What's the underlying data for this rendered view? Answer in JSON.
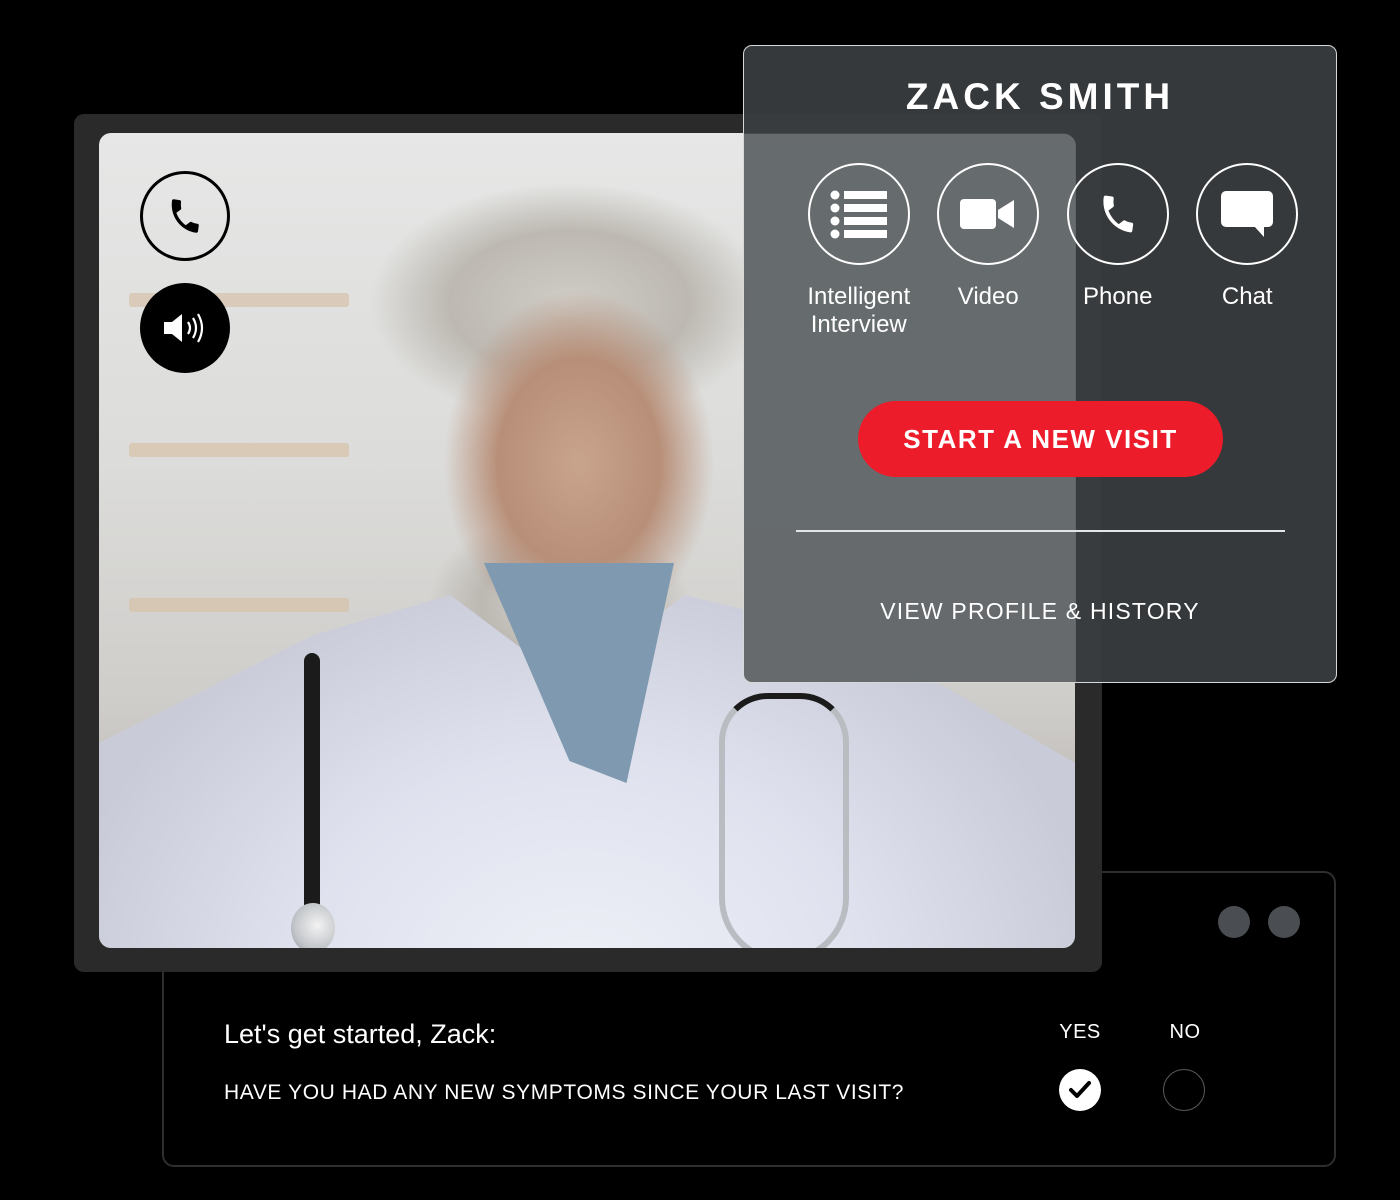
{
  "video_call": {
    "controls": [
      {
        "name": "phone-call",
        "icon": "phone-icon"
      },
      {
        "name": "speaker",
        "icon": "speaker-icon"
      }
    ]
  },
  "profile": {
    "patient_name": "ZACK SMITH",
    "modes": [
      {
        "label": "Intelligent Interview",
        "icon": "list-icon"
      },
      {
        "label": "Video",
        "icon": "video-camera-icon"
      },
      {
        "label": "Phone",
        "icon": "phone-icon"
      },
      {
        "label": "Chat",
        "icon": "chat-bubble-icon"
      }
    ],
    "start_visit_label": "START A NEW VISIT",
    "view_profile_label": "VIEW PROFILE & HISTORY",
    "accent_color": "#ec1c2a"
  },
  "questionnaire": {
    "title": "Let's get started, Zack:",
    "question": "HAVE YOU HAD ANY NEW SYMPTOMS SINCE YOUR LAST VISIT?",
    "options": [
      {
        "label": "YES",
        "selected": true
      },
      {
        "label": "NO",
        "selected": false
      }
    ]
  }
}
